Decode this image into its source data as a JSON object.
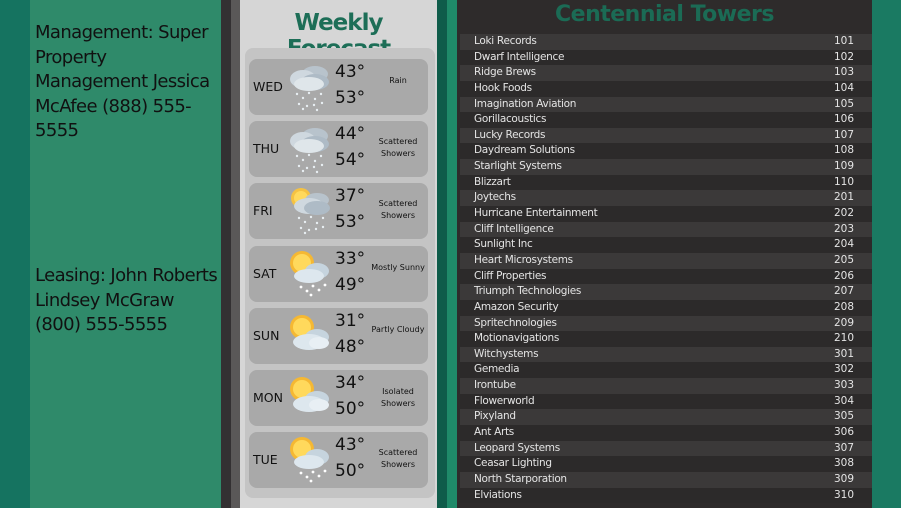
{
  "contacts": {
    "management": "Management: Super Property Management Jessica McAfee (888) 555-5555",
    "leasing": "Leasing: John Roberts Lindsey McGraw (800) 555-5555"
  },
  "forecast": {
    "title": "Weekly Forecast",
    "days": [
      {
        "day": "WED",
        "hi": "43°",
        "lo": "53°",
        "condition": "Rain",
        "icon": "rain-cloud-icon"
      },
      {
        "day": "THU",
        "hi": "44°",
        "lo": "54°",
        "condition": "Scattered Showers",
        "icon": "rain-cloud-icon"
      },
      {
        "day": "FRI",
        "hi": "37°",
        "lo": "53°",
        "condition": "Scattered Showers",
        "icon": "sun-rain-cloud-icon"
      },
      {
        "day": "SAT",
        "hi": "33°",
        "lo": "49°",
        "condition": "Mostly Sunny",
        "icon": "sun-cloud-rain-icon"
      },
      {
        "day": "SUN",
        "hi": "31°",
        "lo": "48°",
        "condition": "Partly Cloudy",
        "icon": "sun-cloud-icon"
      },
      {
        "day": "MON",
        "hi": "34°",
        "lo": "50°",
        "condition": "Isolated Showers",
        "icon": "sun-cloud-icon"
      },
      {
        "day": "TUE",
        "hi": "43°",
        "lo": "50°",
        "condition": "Scattered Showers",
        "icon": "sun-cloud-rain-icon"
      }
    ]
  },
  "directory": {
    "title": "Centennial Towers",
    "tenants": [
      {
        "name": "Loki Records",
        "suite": "101"
      },
      {
        "name": "Dwarf Intelligence",
        "suite": "102"
      },
      {
        "name": "Ridge Brews",
        "suite": "103"
      },
      {
        "name": "Hook Foods",
        "suite": "104"
      },
      {
        "name": "Imagination Aviation",
        "suite": "105"
      },
      {
        "name": "Gorillacoustics",
        "suite": "106"
      },
      {
        "name": "Lucky Records",
        "suite": "107"
      },
      {
        "name": "Daydream Solutions",
        "suite": "108"
      },
      {
        "name": "Starlight Systems",
        "suite": "109"
      },
      {
        "name": "Blizzart",
        "suite": "110"
      },
      {
        "name": "Joytechs",
        "suite": "201"
      },
      {
        "name": "Hurricane Entertainment",
        "suite": "202"
      },
      {
        "name": "Cliff Intelligence",
        "suite": "203"
      },
      {
        "name": "Sunlight Inc",
        "suite": "204"
      },
      {
        "name": "Heart Microsystems",
        "suite": "205"
      },
      {
        "name": "Cliff Properties",
        "suite": "206"
      },
      {
        "name": "Triumph Technologies",
        "suite": "207"
      },
      {
        "name": "Amazon Security",
        "suite": "208"
      },
      {
        "name": "Spritechnologies",
        "suite": "209"
      },
      {
        "name": "Motionavigations",
        "suite": "210"
      },
      {
        "name": "Witchystems",
        "suite": "301"
      },
      {
        "name": "Gemedia",
        "suite": "302"
      },
      {
        "name": "Irontube",
        "suite": "303"
      },
      {
        "name": "Flowerworld",
        "suite": "304"
      },
      {
        "name": "Pixyland",
        "suite": "305"
      },
      {
        "name": "Ant Arts",
        "suite": "306"
      },
      {
        "name": "Leopard Systems",
        "suite": "307"
      },
      {
        "name": "Ceasar Lighting",
        "suite": "308"
      },
      {
        "name": "North Starporation",
        "suite": "309"
      },
      {
        "name": "Elviations",
        "suite": "310"
      }
    ]
  }
}
